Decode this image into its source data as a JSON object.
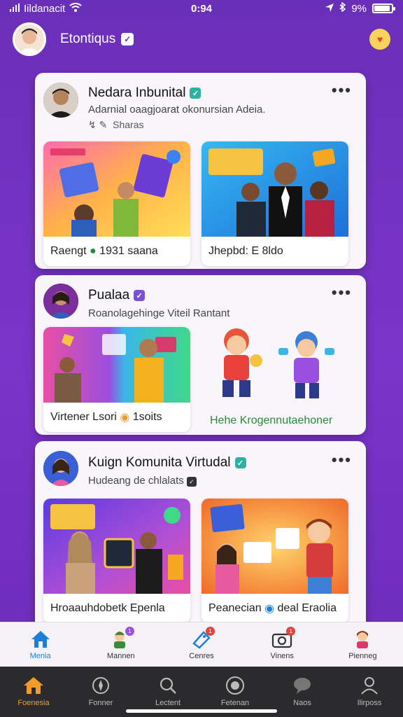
{
  "status": {
    "carrier": "Iildanacit",
    "time": "0:94",
    "battery_text": "9%",
    "battery_level": 0.9
  },
  "header": {
    "title": "Etontiqus",
    "badge": "✓"
  },
  "cards": [
    {
      "title": "Nedara Inbunital",
      "verified_color": "#2ab3a0",
      "subtitle": "Adarnial oaagjoarat okonursian Adeia.",
      "meta": "Sharas",
      "tiles": [
        {
          "label": "Raengt",
          "label2": "1931 saana"
        },
        {
          "label": "Jhepbd: E 8ldo"
        }
      ]
    },
    {
      "title": "Pualaa",
      "verified_color": "#7b4fd6",
      "subtitle": "Roanolagehinge Viteil Rantant",
      "tiles": [
        {
          "label": "Virtener Lsori",
          "label2": "1soits"
        },
        {
          "label": "Hehe Krogennutaehoner",
          "label_color": "#2a8a3a"
        }
      ]
    },
    {
      "title": "Kuign Komunita Virtudal",
      "verified_color": "#2ab3a0",
      "subtitle": "Hudeang de chlalats",
      "tiles": [
        {
          "label": "Hroaauhdobetk Epenla"
        },
        {
          "label": "Peanecian",
          "label2": "deal Eraolia"
        }
      ]
    }
  ],
  "bottom_nav": [
    {
      "label": "Menia",
      "icon": "home-icon",
      "active": true
    },
    {
      "label": "Mannen",
      "icon": "friends-icon",
      "badge": "1"
    },
    {
      "label": "Cenres",
      "icon": "tag-icon",
      "badge": "1"
    },
    {
      "label": "Vinens",
      "icon": "camera-icon",
      "badge": "1"
    },
    {
      "label": "Pienneg",
      "icon": "profile-icon"
    }
  ],
  "system_nav": [
    {
      "label": "Foenesia",
      "icon": "home-icon",
      "active": true
    },
    {
      "label": "Fonner",
      "icon": "compass-icon"
    },
    {
      "label": "Lectent",
      "icon": "search-icon"
    },
    {
      "label": "Fetenan",
      "icon": "record-icon"
    },
    {
      "label": "Naos",
      "icon": "chat-icon"
    },
    {
      "label": "Ilirposs",
      "icon": "user-icon"
    }
  ],
  "colors": {
    "background": "#6a2fb8",
    "accent_blue": "#1b7fd9",
    "accent_orange": "#f39a2c"
  }
}
